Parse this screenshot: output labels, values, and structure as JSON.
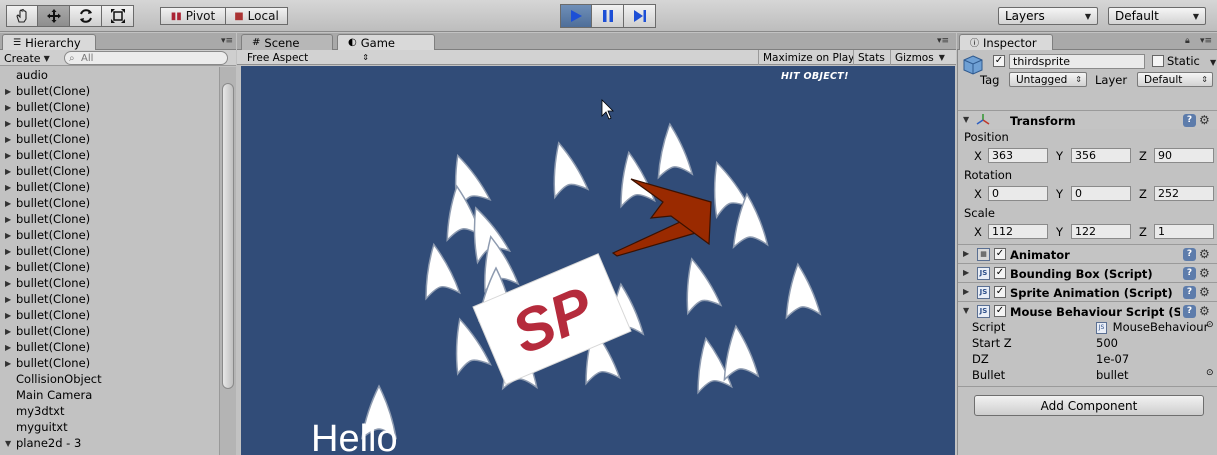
{
  "toolbar": {
    "pivot_label": "Pivot",
    "local_label": "Local",
    "layers_label": "Layers",
    "layout_label": "Default"
  },
  "hierarchy": {
    "tab_label": "Hierarchy",
    "create_label": "Create",
    "search_placeholder": "All",
    "items": [
      {
        "label": "audio",
        "arrow": ""
      },
      {
        "label": "bullet(Clone)",
        "arrow": "▶"
      },
      {
        "label": "bullet(Clone)",
        "arrow": "▶"
      },
      {
        "label": "bullet(Clone)",
        "arrow": "▶"
      },
      {
        "label": "bullet(Clone)",
        "arrow": "▶"
      },
      {
        "label": "bullet(Clone)",
        "arrow": "▶"
      },
      {
        "label": "bullet(Clone)",
        "arrow": "▶"
      },
      {
        "label": "bullet(Clone)",
        "arrow": "▶"
      },
      {
        "label": "bullet(Clone)",
        "arrow": "▶"
      },
      {
        "label": "bullet(Clone)",
        "arrow": "▶"
      },
      {
        "label": "bullet(Clone)",
        "arrow": "▶"
      },
      {
        "label": "bullet(Clone)",
        "arrow": "▶"
      },
      {
        "label": "bullet(Clone)",
        "arrow": "▶"
      },
      {
        "label": "bullet(Clone)",
        "arrow": "▶"
      },
      {
        "label": "bullet(Clone)",
        "arrow": "▶"
      },
      {
        "label": "bullet(Clone)",
        "arrow": "▶"
      },
      {
        "label": "bullet(Clone)",
        "arrow": "▶"
      },
      {
        "label": "bullet(Clone)",
        "arrow": "▶"
      },
      {
        "label": "bullet(Clone)",
        "arrow": "▶"
      },
      {
        "label": "CollisionObject",
        "arrow": ""
      },
      {
        "label": "Main Camera",
        "arrow": ""
      },
      {
        "label": "my3dtxt",
        "arrow": ""
      },
      {
        "label": "myguitxt",
        "arrow": ""
      },
      {
        "label": "plane2d - 3",
        "arrow": "▼"
      }
    ]
  },
  "views": {
    "scene_tab": "Scene",
    "game_tab": "Game",
    "aspect_label": "Free Aspect",
    "maximize_label": "Maximize on Play",
    "stats_label": "Stats",
    "gizmos_label": "Gizmos"
  },
  "game": {
    "hit_text": "HIT OBJECT!",
    "hello_text": "Hello",
    "sprite_text": "SP"
  },
  "inspector": {
    "tab_label": "Inspector",
    "object_name": "thirdsprite",
    "static_label": "Static",
    "tag_label": "Tag",
    "tag_value": "Untagged",
    "layer_label": "Layer",
    "layer_value": "Default",
    "transform": {
      "title": "Transform",
      "position_label": "Position",
      "rotation_label": "Rotation",
      "scale_label": "Scale",
      "x_label": "X",
      "y_label": "Y",
      "z_label": "Z",
      "position": {
        "x": "363",
        "y": "356",
        "z": "90"
      },
      "rotation": {
        "x": "0",
        "y": "0",
        "z": "252"
      },
      "scale": {
        "x": "112",
        "y": "122",
        "z": "1"
      }
    },
    "components": [
      {
        "title": "Animator"
      },
      {
        "title": "Bounding Box (Script)"
      },
      {
        "title": "Sprite Animation (Script)"
      },
      {
        "title": "Mouse Behaviour Script (S"
      }
    ],
    "mouse_script": {
      "script_label": "Script",
      "script_value": "MouseBehaviour",
      "startz_label": "Start Z",
      "startz_value": "500",
      "dz_label": "DZ",
      "dz_value": "1e-07",
      "bullet_label": "Bullet",
      "bullet_value": "bullet"
    },
    "add_component_label": "Add Component"
  },
  "colors": {
    "game_bg": "#314c78",
    "arrow": "#9a2a00",
    "sprite_text": "#b52b3c"
  }
}
